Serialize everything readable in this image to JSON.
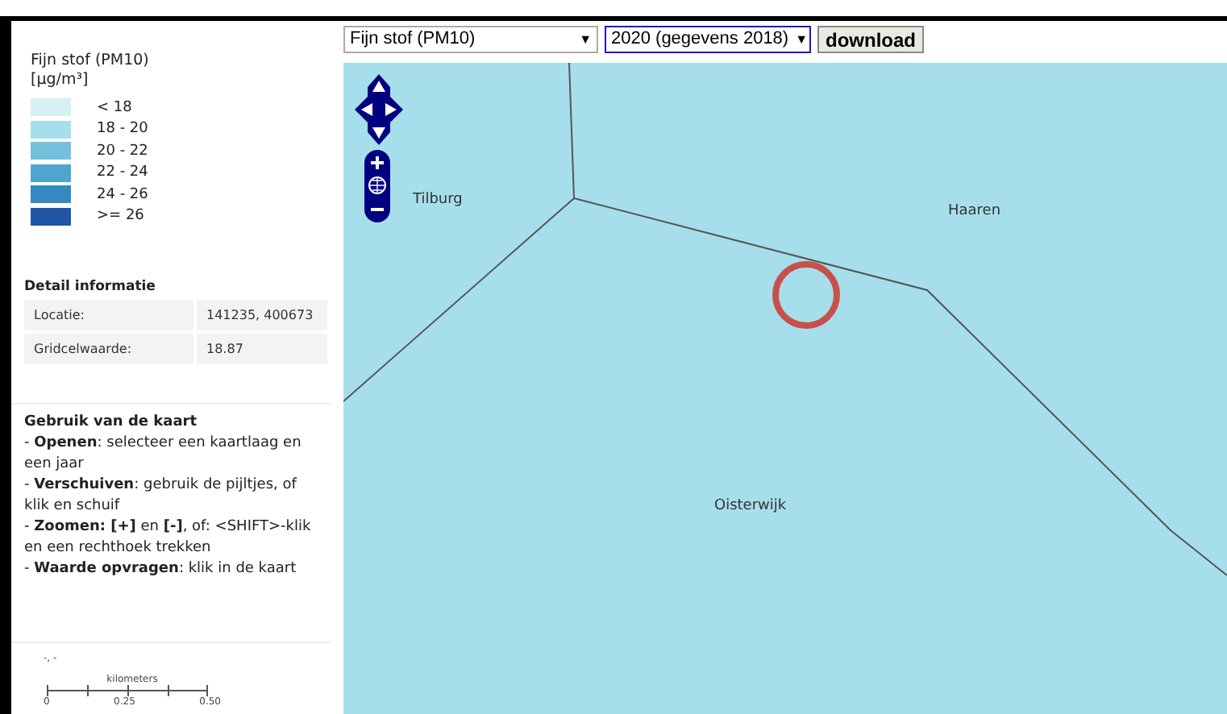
{
  "legend": {
    "title": "Fijn stof (PM10)",
    "unit": "[µg/m³]",
    "items": [
      {
        "label": "< 18",
        "color": "#d7f0f5"
      },
      {
        "label": "18 - 20",
        "color": "#a6dfeb"
      },
      {
        "label": "20 - 22",
        "color": "#74c0dc"
      },
      {
        "label": "22 - 24",
        "color": "#4ea6cf"
      },
      {
        "label": "24 - 26",
        "color": "#3589c0"
      },
      {
        "label": ">= 26",
        "color": "#2055a5"
      }
    ]
  },
  "detail": {
    "title": "Detail informatie",
    "rows": [
      {
        "label": "Locatie:",
        "value": "141235, 400673"
      },
      {
        "label": "Gridcelwaarde:",
        "value": "18.87"
      }
    ]
  },
  "usage": {
    "title": "Gebruik van de kaart",
    "lines": [
      "- **Openen**: selecteer een kaartlaag en een jaar",
      "- **Verschuiven**: gebruik de pijltjes, of klik en schuif",
      "- **Zoomen: [+]** en **[-]**, of: <SHIFT>-klik en een rechthoek trekken",
      "- **Waarde opvragen**: klik in de kaart"
    ]
  },
  "coordinates": "-, -",
  "scale": {
    "unit": "kilometers",
    "ticks": [
      "0",
      "0.25",
      "0.50"
    ]
  },
  "toolbar": {
    "selects": [
      {
        "value": "Fijn stof (PM10)",
        "arrow": "▼",
        "focused": false
      },
      {
        "value": "2020 (gegevens 2018)",
        "arrow": "▼",
        "focused": true
      }
    ],
    "button": "download"
  },
  "map": {
    "places": [
      {
        "name": "Tilburg"
      },
      {
        "name": "Haaren"
      },
      {
        "name": "Oisterwijk"
      }
    ]
  }
}
